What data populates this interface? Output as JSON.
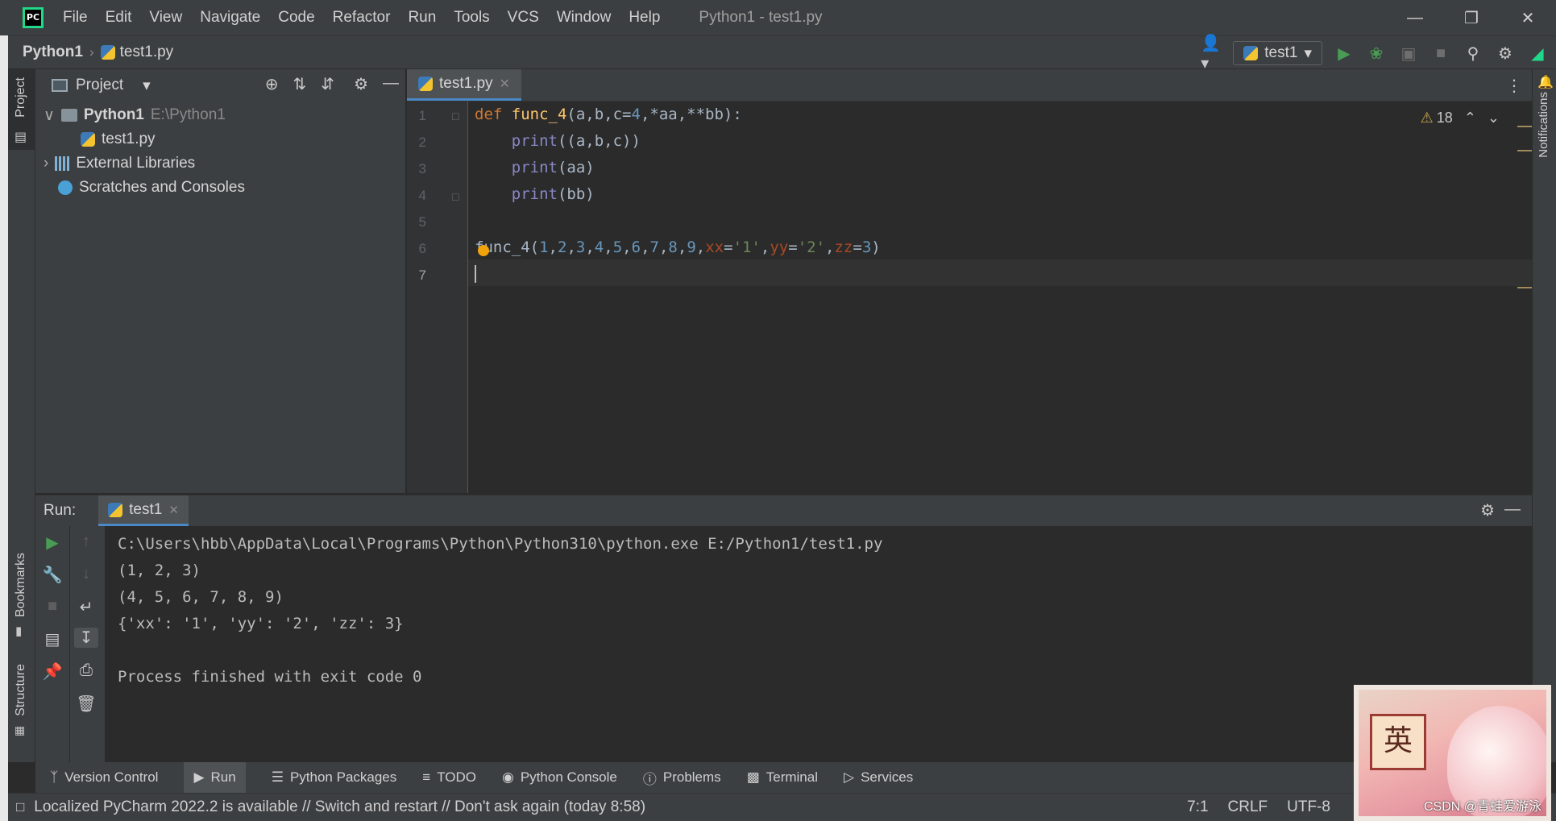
{
  "window": {
    "title": "Python1 - test1.py",
    "menu": [
      "File",
      "Edit",
      "View",
      "Navigate",
      "Code",
      "Refactor",
      "Run",
      "Tools",
      "VCS",
      "Window",
      "Help"
    ]
  },
  "navbar": {
    "project": "Python1",
    "file": "test1.py",
    "run_config": "test1"
  },
  "left_strip": {
    "project_label": "Project",
    "bookmarks_label": "Bookmarks",
    "structure_label": "Structure"
  },
  "right_strip": {
    "notifications_label": "Notifications"
  },
  "project_panel": {
    "title": "Project",
    "root_name": "Python1",
    "root_path": "E:\\Python1",
    "file": "test1.py",
    "external_libraries": "External Libraries",
    "scratches": "Scratches and Consoles"
  },
  "editor": {
    "tab_label": "test1.py",
    "warning_count": "18",
    "line_numbers": [
      "1",
      "2",
      "3",
      "4",
      "5",
      "6",
      "7"
    ]
  },
  "run_panel": {
    "label": "Run:",
    "tab_label": "test1",
    "output": [
      "C:\\Users\\hbb\\AppData\\Local\\Programs\\Python\\Python310\\python.exe E:/Python1/test1.py",
      "(1, 2, 3)",
      "(4, 5, 6, 7, 8, 9)",
      "{'xx': '1', 'yy': '2', 'zz': 3}",
      "",
      "Process finished with exit code 0"
    ]
  },
  "bottom_tabs": [
    "Version Control",
    "Run",
    "Python Packages",
    "TODO",
    "Python Console",
    "Problems",
    "Terminal",
    "Services"
  ],
  "status": {
    "message": "Localized PyCharm 2022.2 is available // Switch and restart // Don't ask again (today 8:58)",
    "position": "7:1",
    "line_sep": "CRLF",
    "encoding": "UTF-8"
  },
  "overlay": {
    "badge_char": "英",
    "watermark": "CSDN @青蛙爱游泳"
  },
  "colors": {
    "accent": "#4a88c7",
    "keyword": "#cc7832",
    "function": "#ffc66d",
    "number": "#6897bb",
    "string": "#6a8759"
  }
}
